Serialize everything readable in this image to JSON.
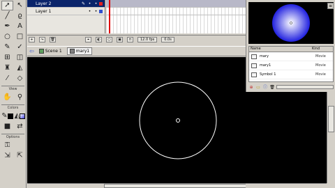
{
  "timeline": {
    "layers": [
      {
        "name": "Layer 2",
        "selected": true
      },
      {
        "name": "Layer 1",
        "selected": false
      }
    ],
    "frame_rate": "12.0 fps",
    "elapsed": "0.0s"
  },
  "edit_bar": {
    "scene": "Scene 1",
    "symbol": "mary1"
  },
  "library": {
    "columns": {
      "name": "Name",
      "kind": "Kind"
    },
    "items": [
      {
        "name": "mary",
        "kind": "Movie"
      },
      {
        "name": "mary1",
        "kind": "Movie"
      },
      {
        "name": "Symbol 1",
        "kind": "Movie"
      }
    ]
  },
  "tools": {
    "view_label": "View",
    "colors_label": "Colors",
    "options_label": "Options"
  },
  "colors": {
    "stage": "#000000",
    "stroke_swatch": "#000000",
    "fill_swatch": "#4040e0"
  }
}
